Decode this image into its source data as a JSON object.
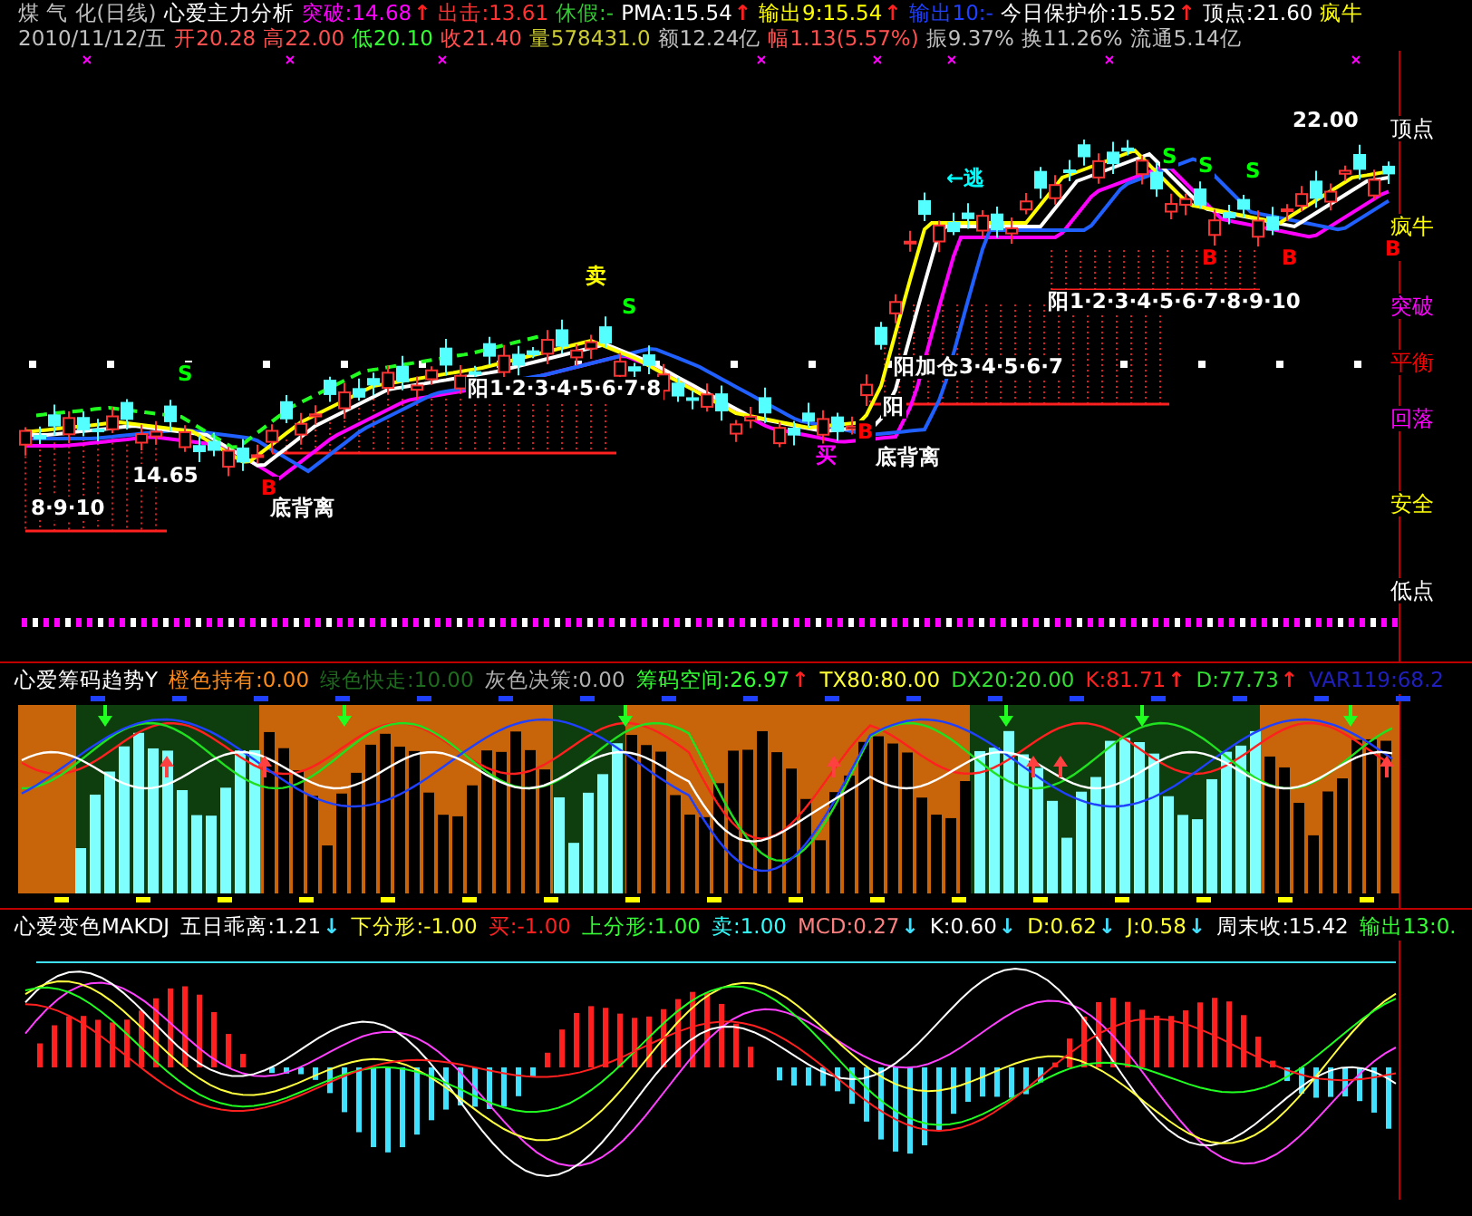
{
  "quote_lines": [
    [
      {
        "text": "煤 气 化(日线)",
        "color": "#c0c0c0"
      },
      {
        "text": "心爱主力分析",
        "color": "#ffffff"
      },
      {
        "text": "突破:14.68",
        "color": "#ff00ff",
        "arrow": {
          "glyph": "↑",
          "color": "#ff2020"
        }
      },
      {
        "text": "出击:13.61",
        "color": "#ff3232"
      },
      {
        "text": "休假:-",
        "color": "#33cc33"
      },
      {
        "text": "PMA:15.54",
        "color": "#ffffff",
        "arrow": {
          "glyph": "↑",
          "color": "#ff2020"
        }
      },
      {
        "text": "输出9:15.54",
        "color": "#ffff00",
        "arrow": {
          "glyph": "↑",
          "color": "#ff2020"
        }
      },
      {
        "text": "输出10:-",
        "color": "#2040ff"
      },
      {
        "text": "今日保护价:15.52",
        "color": "#ffffff",
        "arrow": {
          "glyph": "↑",
          "color": "#ff2020"
        }
      },
      {
        "text": "顶点:21.60",
        "color": "#ffffff"
      },
      {
        "text": "疯牛",
        "color": "#ffff00"
      }
    ],
    [
      {
        "text": "2010/11/12/五",
        "color": "#c0c0c0"
      },
      {
        "text": "开20.28",
        "color": "#ff5050"
      },
      {
        "text": "高22.00",
        "color": "#ff5050"
      },
      {
        "text": "低20.10",
        "color": "#33ff33"
      },
      {
        "text": "收21.40",
        "color": "#ff5050"
      },
      {
        "text": "量578431.0",
        "color": "#cccc33"
      },
      {
        "text": "额12.24亿",
        "color": "#c0c0c0"
      },
      {
        "text": "幅1.13(5.57%)",
        "color": "#ff5050"
      },
      {
        "text": "振9.37%",
        "color": "#c0c0c0"
      },
      {
        "text": "换11.26%",
        "color": "#c0c0c0"
      },
      {
        "text": "流通5.14亿",
        "color": "#c0c0c0"
      }
    ]
  ],
  "price_chart": {
    "annotations": [
      {
        "text": "22.00",
        "color": "#ffffff"
      },
      {
        "text": "14.65",
        "color": "#ffffff"
      },
      {
        "text": "卖",
        "color": "#ffff00"
      },
      {
        "text": "S",
        "color": "#00ff00"
      },
      {
        "text": "S",
        "color": "#00ff00"
      },
      {
        "text": "S",
        "color": "#00ff00"
      },
      {
        "text": "S",
        "color": "#00ff00"
      },
      {
        "text": "S",
        "color": "#00ff00"
      },
      {
        "text": "B",
        "color": "#ff0000"
      },
      {
        "text": "B",
        "color": "#ff0000"
      },
      {
        "text": "B",
        "color": "#ff0000"
      },
      {
        "text": "B",
        "color": "#ff0000"
      },
      {
        "text": "B",
        "color": "#ff0000"
      },
      {
        "text": "买",
        "color": "#ff00ff"
      },
      {
        "text": "底背离",
        "color": "#ffffff"
      },
      {
        "text": "阳",
        "color": "#ffffff"
      },
      {
        "text": "底背离",
        "color": "#ffffff"
      },
      {
        "text": "阳1·2·3·4·5·6·7·8",
        "color": "#ffffff"
      },
      {
        "text": "阳1·2·3·4·5·6·7·8·9·10",
        "color": "#ffffff"
      },
      {
        "text": "阳加仓3·4·5·6·7",
        "color": "#ffffff"
      },
      {
        "text": "←逃",
        "color": "#00ffff"
      },
      {
        "text": "8·9·10",
        "color": "#ffffff"
      }
    ],
    "scale_labels": [
      {
        "text": "顶点",
        "color": "#ffffff"
      },
      {
        "text": "疯牛",
        "color": "#ffff00"
      },
      {
        "text": "突破",
        "color": "#ff00ff"
      },
      {
        "text": "平衡",
        "color": "#ff0000"
      },
      {
        "text": "回落",
        "color": "#ff00ff"
      },
      {
        "text": "安全",
        "color": "#ffff00"
      },
      {
        "text": "低点",
        "color": "#ffffff"
      }
    ]
  },
  "chip_panel": {
    "kind": "chip",
    "header": [
      {
        "text": "心爱筹码趋势Y",
        "color": "#ffffff"
      },
      {
        "text": "橙色持有:0.00",
        "color": "#ff8c1a"
      },
      {
        "text": "绿色快走:10.00",
        "color": "#1f6b1f"
      },
      {
        "text": "灰色决策:0.00",
        "color": "#b0b0b0"
      },
      {
        "text": "筹码空间:26.97",
        "color": "#33ff33",
        "arrow": {
          "glyph": "↑",
          "color": "#ff2020"
        }
      },
      {
        "text": "TX80:80.00",
        "color": "#ffff33"
      },
      {
        "text": "DX20:20.00",
        "color": "#33dd33"
      },
      {
        "text": "K:81.71",
        "color": "#ff2020",
        "arrow": {
          "glyph": "↑",
          "color": "#ff2020"
        }
      },
      {
        "text": "D:77.73",
        "color": "#33dd33",
        "arrow": {
          "glyph": "↑",
          "color": "#ff2020"
        }
      },
      {
        "text": "VAR119:68.2",
        "color": "#2020c0"
      }
    ]
  },
  "kdj_panel": {
    "kind": "kdj",
    "header": [
      {
        "text": "心爱变色MAKDJ",
        "color": "#ffffff"
      },
      {
        "text": "五日乖离:1.21",
        "color": "#ffffff",
        "arrow": {
          "glyph": "↓",
          "color": "#40e0ff"
        }
      },
      {
        "text": "下分形:-1.00",
        "color": "#ffff33"
      },
      {
        "text": "买:-1.00",
        "color": "#ff2020"
      },
      {
        "text": "上分形:1.00",
        "color": "#33ff33"
      },
      {
        "text": "卖:1.00",
        "color": "#33ffff"
      },
      {
        "text": "MCD:0.27",
        "color": "#ff8080",
        "arrow": {
          "glyph": "↓",
          "color": "#40e0ff"
        }
      },
      {
        "text": "K:0.60",
        "color": "#ffffff",
        "arrow": {
          "glyph": "↓",
          "color": "#40e0ff"
        }
      },
      {
        "text": "D:0.62",
        "color": "#ffff33",
        "arrow": {
          "glyph": "↓",
          "color": "#40e0ff"
        }
      },
      {
        "text": "J:0.58",
        "color": "#ffff33",
        "arrow": {
          "glyph": "↓",
          "color": "#40e0ff"
        }
      },
      {
        "text": "周末收:15.42",
        "color": "#ffffff"
      },
      {
        "text": "输出13:0.",
        "color": "#33ff33"
      }
    ]
  }
}
